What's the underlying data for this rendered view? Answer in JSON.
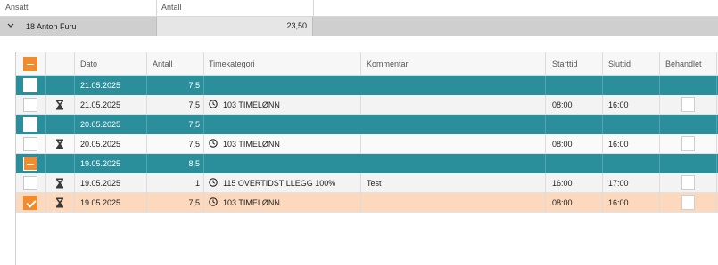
{
  "top_header": {
    "col_employee": "Ansatt",
    "col_amount": "Antall"
  },
  "group": {
    "chevron_icon": "chevron-down-icon",
    "employee": "18 Anton Furu",
    "total": "23,50"
  },
  "detail_header": {
    "date": "Dato",
    "amount": "Antall",
    "category": "Timekategori",
    "comment": "Kommentar",
    "start": "Starttid",
    "end": "Sluttid",
    "processed": "Behandlet"
  },
  "rows": [
    {
      "kind": "day",
      "date": "21.05.2025",
      "amount": "7,5",
      "checkbox": "empty"
    },
    {
      "kind": "entry",
      "date": "21.05.2025",
      "amount": "7,5",
      "category": "103 TIMELØNN",
      "comment": "",
      "start": "08:00",
      "end": "16:00",
      "checkbox": "empty"
    },
    {
      "kind": "day",
      "date": "20.05.2025",
      "amount": "7,5",
      "checkbox": "empty"
    },
    {
      "kind": "entry",
      "date": "20.05.2025",
      "amount": "7,5",
      "category": "103 TIMELØNN",
      "comment": "",
      "start": "08:00",
      "end": "16:00",
      "checkbox": "empty"
    },
    {
      "kind": "day",
      "date": "19.05.2025",
      "amount": "8,5",
      "checkbox": "partial"
    },
    {
      "kind": "entry",
      "date": "19.05.2025",
      "amount": "1",
      "category": "115 OVERTIDSTILLEGG 100%",
      "comment": "Test",
      "start": "16:00",
      "end": "17:00",
      "checkbox": "empty"
    },
    {
      "kind": "entry",
      "date": "19.05.2025",
      "amount": "7,5",
      "category": "103 TIMELØNN",
      "comment": "",
      "start": "08:00",
      "end": "16:00",
      "checkbox": "checked",
      "selected": true
    }
  ],
  "colors": {
    "day_row": "#2a8f9b",
    "accent": "#f28a2e",
    "selected_row": "#fcd9bd",
    "group_row": "#cfcfcf"
  }
}
